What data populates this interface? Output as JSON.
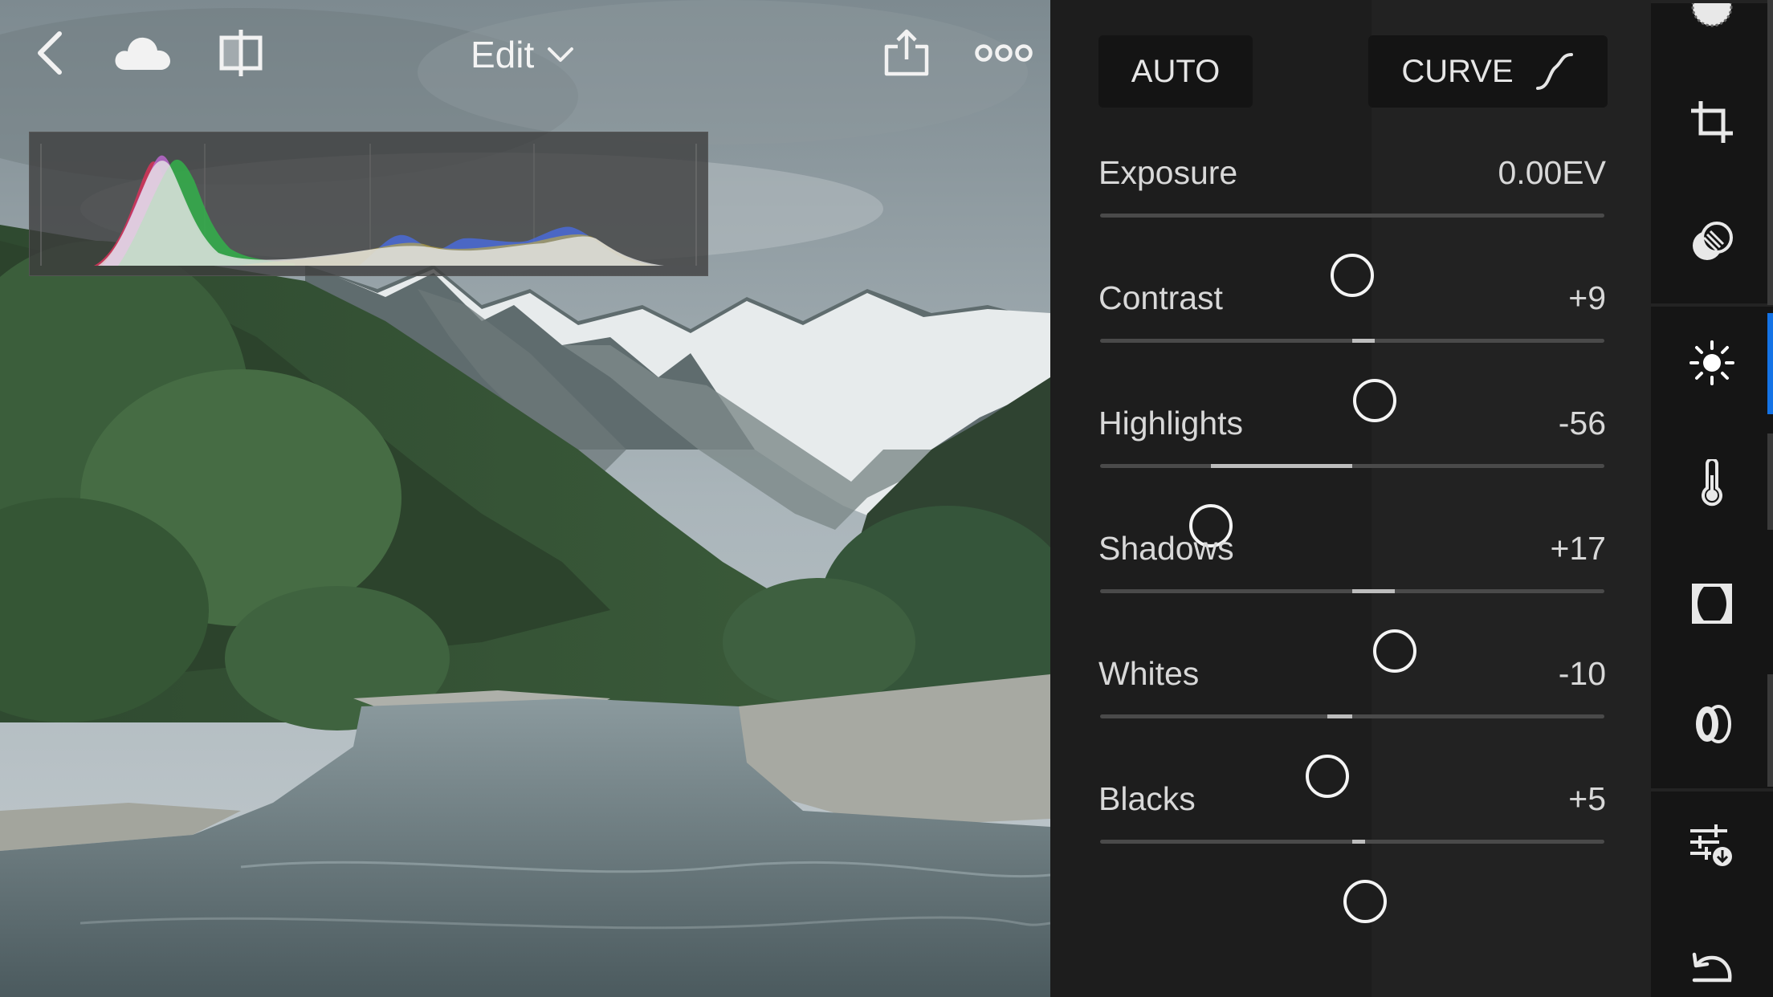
{
  "toolbar": {
    "edit_label": "Edit"
  },
  "panel": {
    "auto_label": "AUTO",
    "curve_label": "CURVE",
    "adjustments": [
      {
        "label": "Exposure",
        "value": "0.00EV",
        "level": 0.0
      },
      {
        "label": "Contrast",
        "value": "+9",
        "level": 0.09
      },
      {
        "label": "Highlights",
        "value": "-56",
        "level": -0.56
      },
      {
        "label": "Shadows",
        "value": "+17",
        "level": 0.17
      },
      {
        "label": "Whites",
        "value": "-10",
        "level": -0.1
      },
      {
        "label": "Blacks",
        "value": "+5",
        "level": 0.05
      }
    ]
  },
  "rail": {
    "icons": [
      "presets-icon",
      "crop-icon",
      "selective-icon",
      "light-icon",
      "color-icon",
      "vignette-icon",
      "optics-icon",
      "adjust-icon",
      "undo-icon"
    ],
    "active": "light-icon"
  },
  "colors": {
    "accent": "#1473e6",
    "panel_bg": "#1d1d1d",
    "rail_bg": "#151515"
  }
}
